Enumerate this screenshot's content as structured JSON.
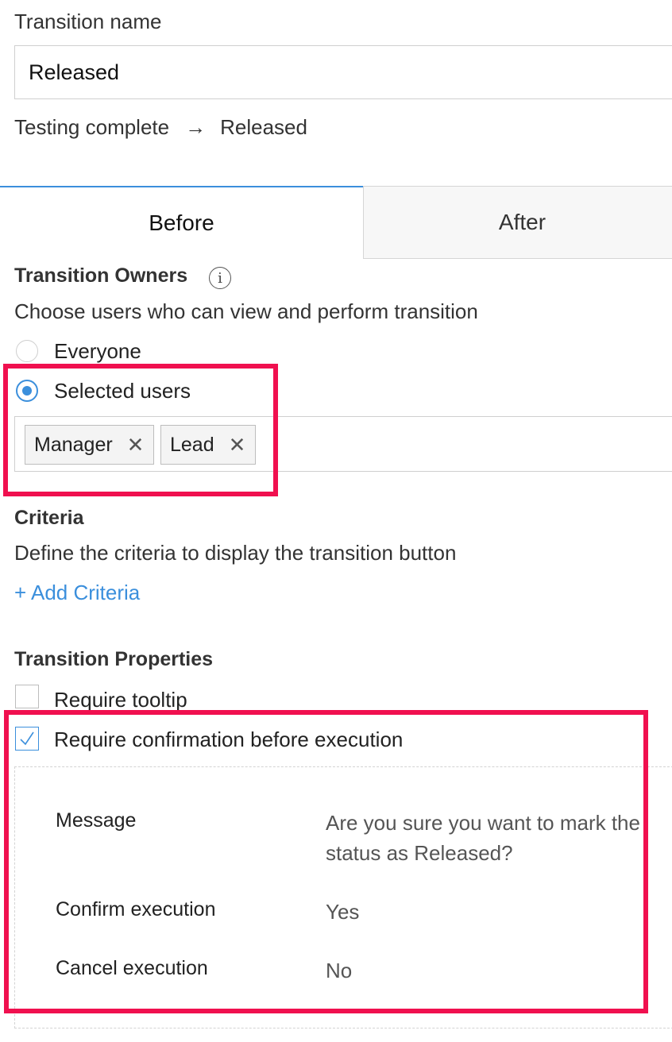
{
  "transition_name": {
    "label": "Transition name",
    "value": "Released"
  },
  "flow": {
    "from": "Testing complete",
    "arrow": "→",
    "to": "Released"
  },
  "tabs": [
    {
      "label": "Before",
      "active": true
    },
    {
      "label": "After",
      "active": false
    }
  ],
  "owners": {
    "title": "Transition Owners",
    "info_icon": "i",
    "description": "Choose users who can view and perform transition",
    "options": [
      {
        "label": "Everyone",
        "selected": false
      },
      {
        "label": "Selected users",
        "selected": true
      }
    ],
    "chips": [
      {
        "label": "Manager",
        "remove": "✕"
      },
      {
        "label": "Lead",
        "remove": "✕"
      }
    ]
  },
  "criteria": {
    "title": "Criteria",
    "description": "Define the criteria to display the transition button",
    "add_link": "+ Add Criteria"
  },
  "properties": {
    "title": "Transition Properties",
    "options": [
      {
        "label": "Require tooltip",
        "checked": false
      },
      {
        "label": "Require confirmation before execution",
        "checked": true
      }
    ]
  },
  "confirmation": {
    "message_label": "Message",
    "message_value": "Are you sure you want to mark the status as Released?",
    "confirm_label": "Confirm execution",
    "confirm_value": "Yes",
    "cancel_label": "Cancel execution",
    "cancel_value": "No"
  },
  "colors": {
    "accent": "#3b8fdc",
    "highlight": "#f0104f"
  }
}
